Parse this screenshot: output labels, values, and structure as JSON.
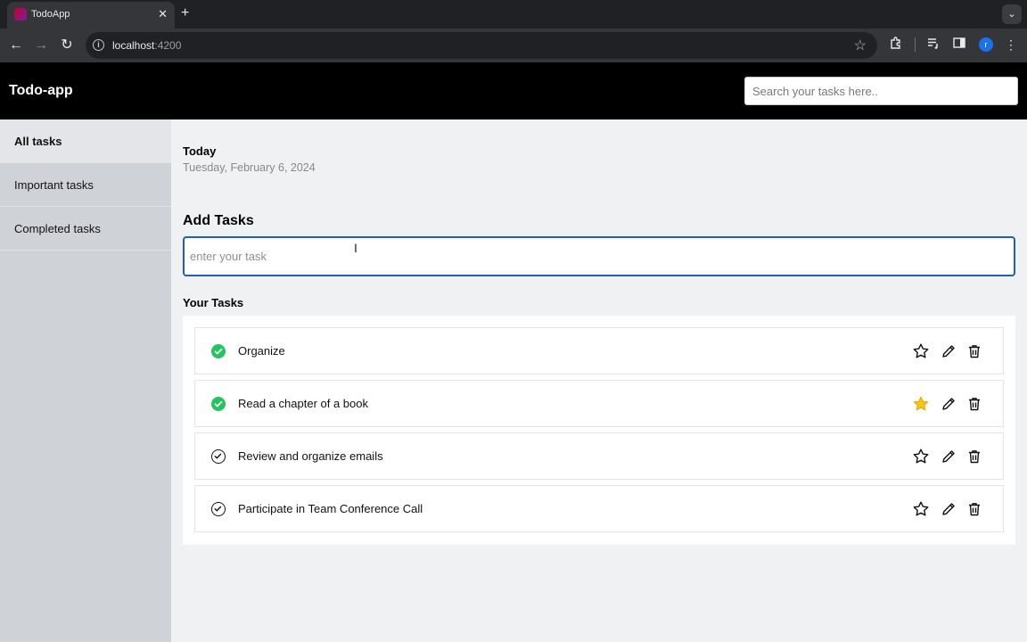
{
  "browser": {
    "tab_title": "TodoApp",
    "tab_close": "✕",
    "new_tab": "+",
    "url_host": "localhost",
    "url_port": ":4200",
    "profile_initial": "r"
  },
  "header": {
    "brand": "Todo-app",
    "search_placeholder": "Search your tasks here.."
  },
  "sidebar": {
    "items": [
      {
        "label": "All tasks",
        "active": true
      },
      {
        "label": "Important tasks",
        "active": false
      },
      {
        "label": "Completed tasks",
        "active": false
      }
    ]
  },
  "main": {
    "today_label": "Today",
    "date": "Tuesday, February 6, 2024",
    "add_title": "Add Tasks",
    "input_placeholder": "enter your task",
    "your_tasks_title": "Your Tasks",
    "tasks": [
      {
        "text": "Organize",
        "completed": true,
        "important": false
      },
      {
        "text": "Read a chapter of a book",
        "completed": true,
        "important": true
      },
      {
        "text": "Review and organize emails",
        "completed": false,
        "important": false
      },
      {
        "text": "Participate in Team Conference Call",
        "completed": false,
        "important": false
      }
    ]
  },
  "colors": {
    "completed": "#22c55e",
    "important_star": "#f5c518",
    "input_focus": "#1f5fb8",
    "header_bg": "#000000",
    "sidebar_bg": "#cfd2d7"
  },
  "icons": {
    "complete": "check-circle-icon",
    "important": "star-icon",
    "edit": "pencil-icon",
    "delete": "trash-icon"
  }
}
